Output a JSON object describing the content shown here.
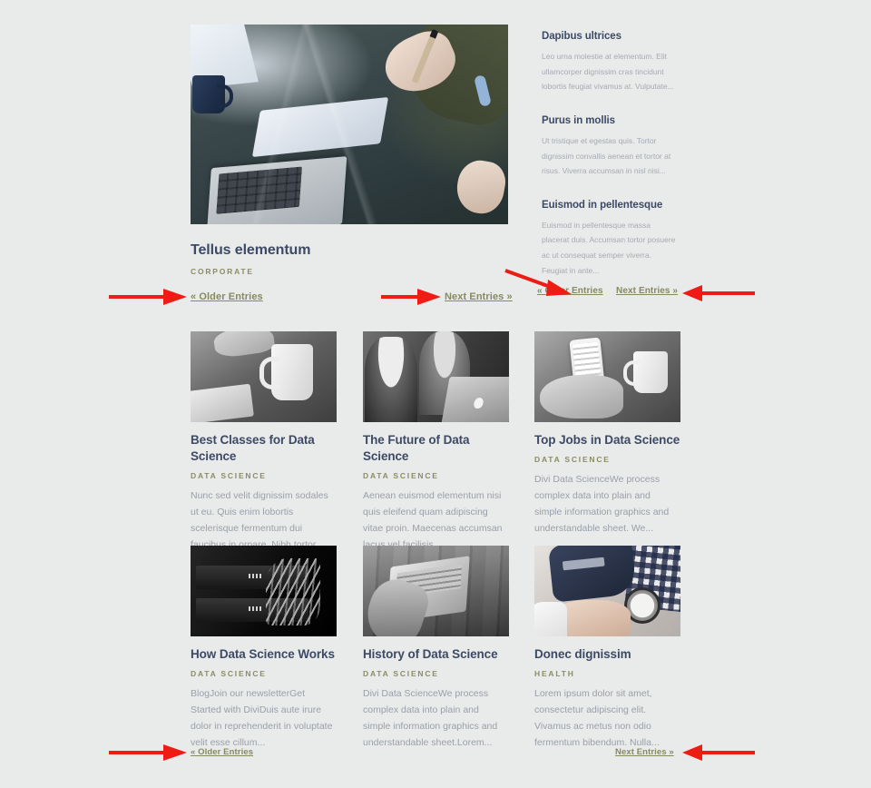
{
  "theme": {
    "page_background": "#e9eaea",
    "title_color": "#3d4a66",
    "meta_color": "#8b8d63",
    "excerpt_color": "#9aa0a8",
    "link_color": "#868a5f",
    "annotation_color": "#ee1c14"
  },
  "featured": {
    "image_name": "hands-writing-laptop-photo",
    "title": "Tellus elementum",
    "category": "CORPORATE"
  },
  "sidebar": {
    "entries": [
      {
        "title": "Dapibus ultrices",
        "excerpt": "Leo urna molestie at elementum. Elit ullamcorper dignissim cras tincidunt lobortis feugiat vivamus at. Vulputate...",
        "image_name": "dapibus-ultrices-entry"
      },
      {
        "title": "Purus in mollis",
        "excerpt": "Ut tristique et egestas quis. Tortor dignissim convallis aenean et tortor at risus. Viverra accumsan in nisl nisi...",
        "image_name": "purus-in-mollis-entry"
      },
      {
        "title": "Euismod in pellentesque",
        "excerpt": "Euismod in pellentesque massa placerat duis. Accumsan tortor posuere ac ut consequat semper viverra. Feugiat in ante...",
        "image_name": "euismod-in-pellentesque-entry"
      }
    ],
    "pager": {
      "older": "« Older Entries",
      "next": "Next Entries »"
    }
  },
  "main_pager": {
    "older": "« Older Entries",
    "next": "Next Entries »"
  },
  "bottom_pager": {
    "older": "« Older Entries",
    "next": "Next Entries »"
  },
  "grid_rows": [
    {
      "row_name": "posts-row-1",
      "posts": [
        {
          "title": "Best Classes for Data Science",
          "category": "DATA SCIENCE",
          "excerpt": "Nunc sed velit dignissim sodales ut eu. Quis enim lobortis scelerisque fermentum dui faucibus in ornare. Nibh tortor...",
          "image_name": "mug-notebook-photo"
        },
        {
          "title": "The Future of Data Science",
          "category": "DATA SCIENCE",
          "excerpt": "Aenean euismod elementum nisi quis eleifend quam adipiscing vitae proin. Maecenas accumsan lacus vel facilisis...",
          "image_name": "two-people-laptop-photo"
        },
        {
          "title": "Top Jobs in Data Science",
          "category": "DATA SCIENCE",
          "excerpt": "Divi Data ScienceWe process complex data into plain and simple information graphics and understandable sheet. We...",
          "image_name": "phone-in-hands-photo"
        }
      ]
    },
    {
      "row_name": "posts-row-2",
      "posts": [
        {
          "title": "How Data Science Works",
          "category": "DATA SCIENCE",
          "excerpt": "BlogJoin our newsletterGet Started with DiviDuis aute irure dolor in reprehenderit in voluptate velit esse cillum...",
          "image_name": "server-rack-photo"
        },
        {
          "title": "History of Data Science",
          "category": "DATA SCIENCE",
          "excerpt": "Divi Data ScienceWe process complex data into plain and simple information graphics and understandable sheet.Lorem...",
          "image_name": "laptop-on-bench-photo"
        },
        {
          "title": "Donec dignissim",
          "category": "HEALTH",
          "excerpt": "Lorem ipsum dolor sit amet, consectetur adipiscing elit. Vivamus ac metus non odio fermentum bibendum. Nulla...",
          "image_name": "blood-pressure-cuff-photo"
        }
      ]
    }
  ],
  "annotations": [
    {
      "name": "arrow-to-main-older-entries",
      "direction": "right"
    },
    {
      "name": "arrow-to-main-next-entries",
      "direction": "right"
    },
    {
      "name": "arrow-to-sidebar-older-entries",
      "direction": "diagonal-down-right"
    },
    {
      "name": "arrow-to-sidebar-next-entries",
      "direction": "left"
    },
    {
      "name": "arrow-to-bottom-older-entries",
      "direction": "right"
    },
    {
      "name": "arrow-to-bottom-next-entries",
      "direction": "left"
    }
  ]
}
